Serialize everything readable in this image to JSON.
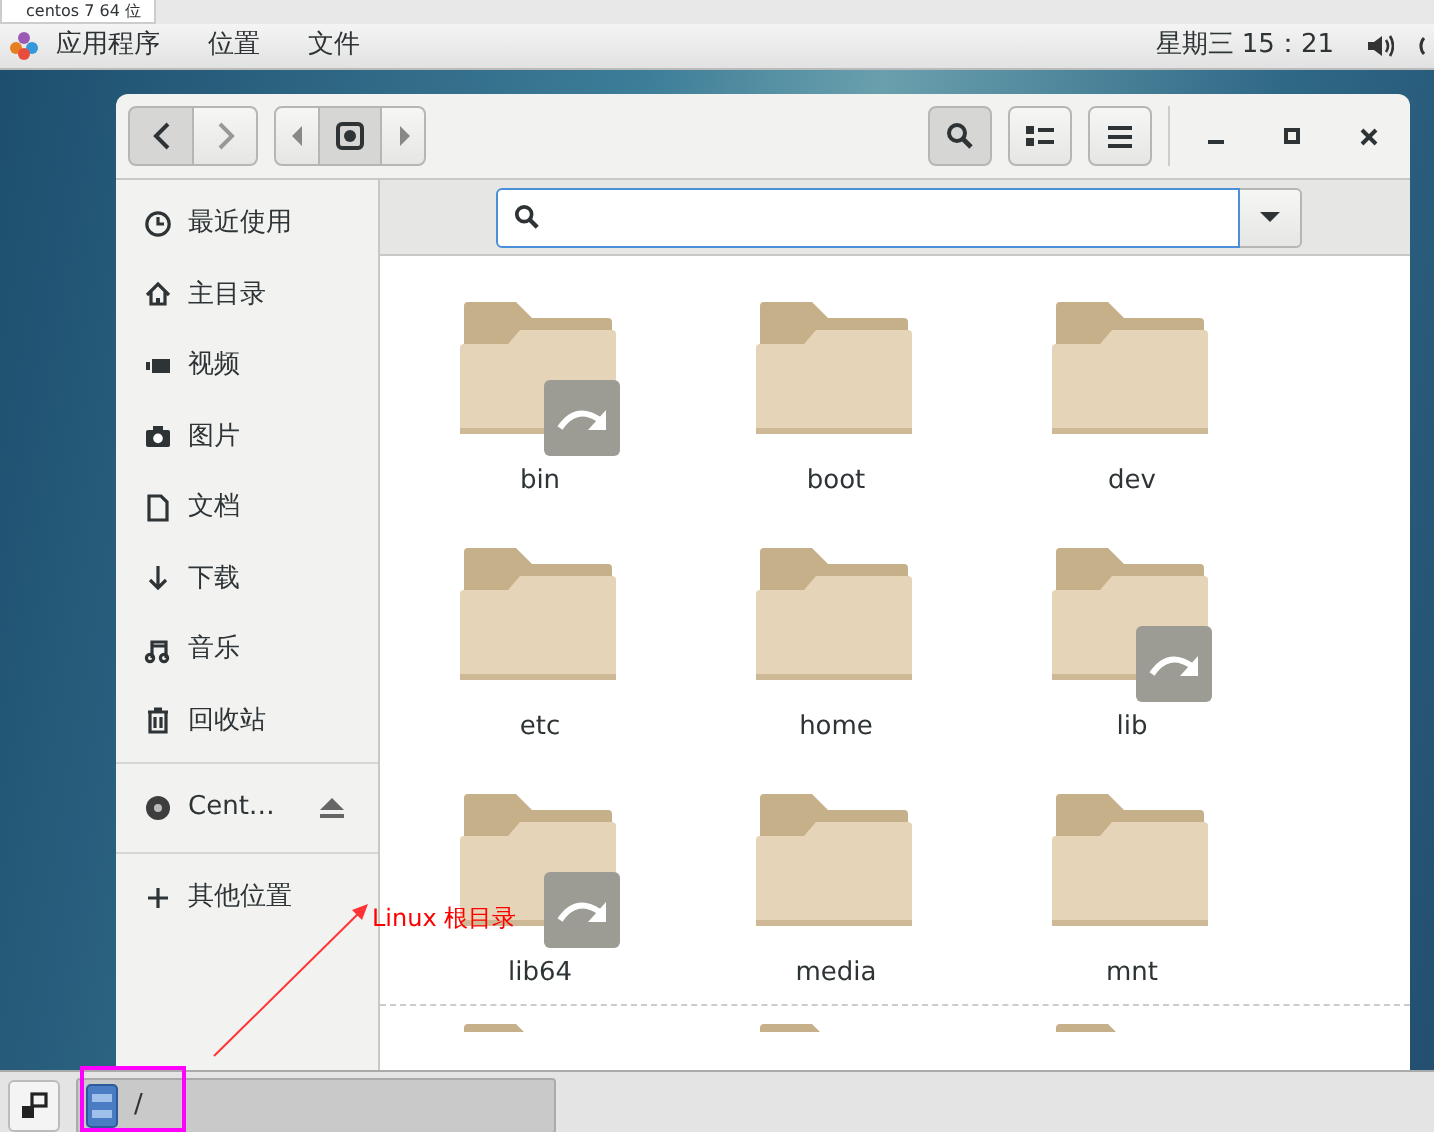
{
  "vm_tab": {
    "title": "centos 7 64 位"
  },
  "top_bar": {
    "menus": [
      "应用程序",
      "位置",
      "文件"
    ],
    "clock": "星期三 15：21"
  },
  "sidebar": {
    "items": [
      {
        "kind": "place",
        "label": "最近使用"
      },
      {
        "kind": "place",
        "label": "主目录"
      },
      {
        "kind": "place",
        "label": "视频"
      },
      {
        "kind": "place",
        "label": "图片"
      },
      {
        "kind": "place",
        "label": "文档"
      },
      {
        "kind": "place",
        "label": "下载"
      },
      {
        "kind": "place",
        "label": "音乐"
      },
      {
        "kind": "place",
        "label": "回收站"
      },
      {
        "kind": "device",
        "label": "Cent…"
      },
      {
        "kind": "other",
        "label": "其他位置"
      }
    ]
  },
  "folders": [
    {
      "name": "bin",
      "symlink": true
    },
    {
      "name": "boot",
      "symlink": false
    },
    {
      "name": "dev",
      "symlink": false
    },
    {
      "name": "etc",
      "symlink": false
    },
    {
      "name": "home",
      "symlink": false
    },
    {
      "name": "lib",
      "symlink": true
    },
    {
      "name": "lib64",
      "symlink": true
    },
    {
      "name": "media",
      "symlink": false
    },
    {
      "name": "mnt",
      "symlink": false
    }
  ],
  "annotation": {
    "text": "Linux 根目录"
  },
  "taskbar": {
    "task": "/"
  }
}
